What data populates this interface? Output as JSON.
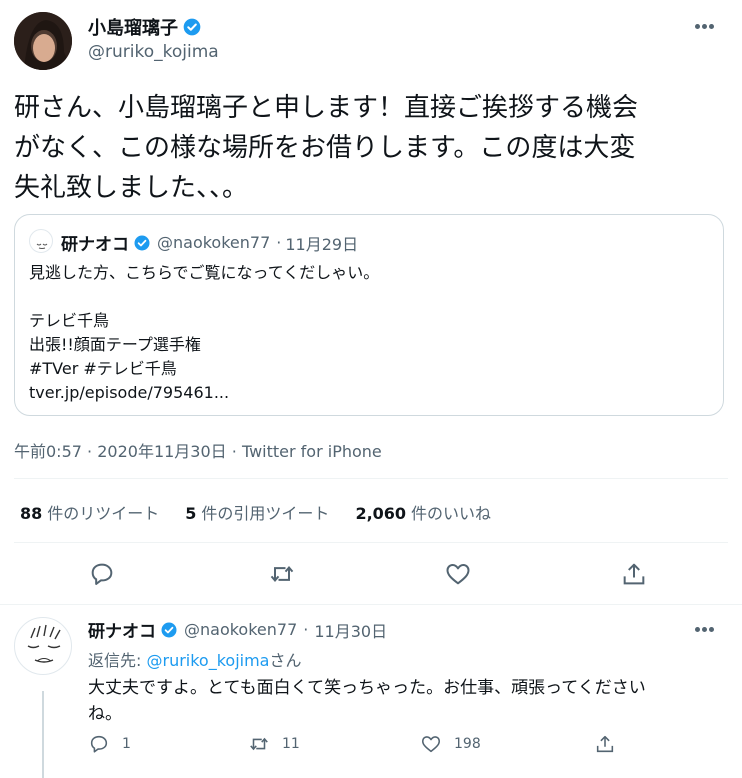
{
  "main_tweet": {
    "display_name": "小島瑠璃子",
    "handle": "@ruriko_kojima",
    "text_lines": [
      "研さん、小島瑠璃子と申します！直接ご挨拶する機会",
      "がなく、この様な場所をお借りします。この度は大変",
      "失礼致しました、、。"
    ],
    "quote": {
      "display_name": "研ナオコ",
      "handle": "@naokoken77",
      "sep": "·",
      "date": "11月29日",
      "lines": [
        "見逃した方、こちらでご覧になってくだしゃい。",
        "",
        "テレビ千鳥",
        "出張!!顔面テープ選手権",
        "#TVer #テレビ千鳥",
        "tver.jp/episode/795461..."
      ]
    },
    "meta": {
      "time": "午前0:57",
      "sep1": "·",
      "date": "2020年11月30日",
      "sep2": "·",
      "source": "Twitter for iPhone"
    },
    "stats": {
      "retweets_count": "88",
      "retweets_label": "件のリツイート",
      "quotes_count": "5",
      "quotes_label": "件の引用ツイート",
      "likes_count": "2,060",
      "likes_label": "件のいいね"
    }
  },
  "reply": {
    "display_name": "研ナオコ",
    "handle": "@naokoken77",
    "sep": "·",
    "date": "11月30日",
    "reply_prefix": "返信先: ",
    "reply_to": "@ruriko_kojima",
    "reply_suffix": "さん",
    "text_lines": [
      "大丈夫ですよ。とても面白くて笑っちゃった。お仕事、頑張ってください",
      "ね。"
    ],
    "reply_count": "1",
    "retweet_count": "11",
    "like_count": "198"
  },
  "icons": {
    "verified": "verified-badge-icon",
    "more": "more-icon",
    "reply": "reply-icon",
    "retweet": "retweet-icon",
    "like": "heart-icon",
    "share": "share-icon"
  },
  "colors": {
    "accent": "#1d9bf0",
    "text": "#0f1419",
    "muted": "#536471",
    "border": "#cfd9de"
  }
}
